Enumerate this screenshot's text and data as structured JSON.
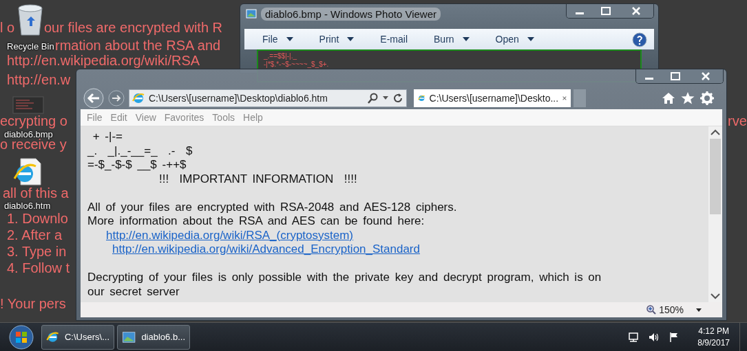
{
  "desktop": {
    "wallpaper_lines": [
      {
        "text": "l o"
      },
      {
        "text": "our files are encrypted with R"
      },
      {
        "text": "rmation about the RSA and"
      },
      {
        "text": "http://en.wikipedia.org/wiki/RSA"
      },
      {
        "text": "http://en.w"
      },
      {
        "text": "ecrypting o"
      },
      {
        "text": "o receive y"
      },
      {
        "text": "all of this a"
      },
      {
        "text": "1. Downlo"
      },
      {
        "text": "2. After a"
      },
      {
        "text": "3. Type in"
      },
      {
        "text": "4. Follow t"
      },
      {
        "text": "! Your pers"
      },
      {
        "text": "rve"
      }
    ],
    "icons": [
      {
        "label": "Recycle Bin",
        "kind": "recycle"
      },
      {
        "label": "diablo6.bmp",
        "kind": "bitmap"
      },
      {
        "label": "diablo6.htm",
        "kind": "webpage"
      }
    ]
  },
  "photo_viewer": {
    "title": "diablo6.bmp - Windows Photo Viewer",
    "menu": [
      {
        "label": "File",
        "dropdown": true
      },
      {
        "label": "Print",
        "dropdown": true
      },
      {
        "label": "E-mail",
        "dropdown": false
      },
      {
        "label": "Burn",
        "dropdown": true
      },
      {
        "label": "Open",
        "dropdown": true
      }
    ],
    "image_lines": [
      "_.==$$|-|._",
      "-|*$.*-~$-~~~~_$_$+."
    ]
  },
  "browser": {
    "address": "C:\\Users\\[username]\\Desktop\\diablo6.htm",
    "tabs": [
      {
        "title": "C:\\Users\\[username]\\Deskto...",
        "selected": true
      }
    ],
    "menu": [
      "File",
      "Edit",
      "View",
      "Favorites",
      "Tools",
      "Help"
    ],
    "content": [
      {
        "kind": "art",
        "text": " + -|-="
      },
      {
        "kind": "art",
        "text": "_.  _|._-__=_  .-  $"
      },
      {
        "kind": "art",
        "text": "=-$_-$-$ __$ -++$"
      },
      {
        "kind": "heading",
        "text": "!!!  IMPORTANT INFORMATION  !!!!"
      },
      {
        "kind": "blank"
      },
      {
        "kind": "text",
        "text": "All of your files are encrypted with RSA-2048 and AES-128 ciphers."
      },
      {
        "kind": "text",
        "text": "More information about the RSA and AES can be found here:"
      },
      {
        "kind": "link",
        "text": "http://en.wikipedia.org/wiki/RSA_(cryptosystem)"
      },
      {
        "kind": "link",
        "text": "http://en.wikipedia.org/wiki/Advanced_Encryption_Standard"
      },
      {
        "kind": "blank"
      },
      {
        "kind": "text",
        "text": "Decrypting of your files is only possible with the private key and decrypt program, which is on"
      },
      {
        "kind": "text",
        "text": "our secret server"
      }
    ],
    "zoom": "150%"
  },
  "taskbar": {
    "buttons": [
      {
        "label": "C:\\Users\\...",
        "kind": "browser"
      },
      {
        "label": "diablo6.b...",
        "kind": "photo"
      }
    ],
    "time": "4:12 PM",
    "date": "8/9/2017"
  }
}
